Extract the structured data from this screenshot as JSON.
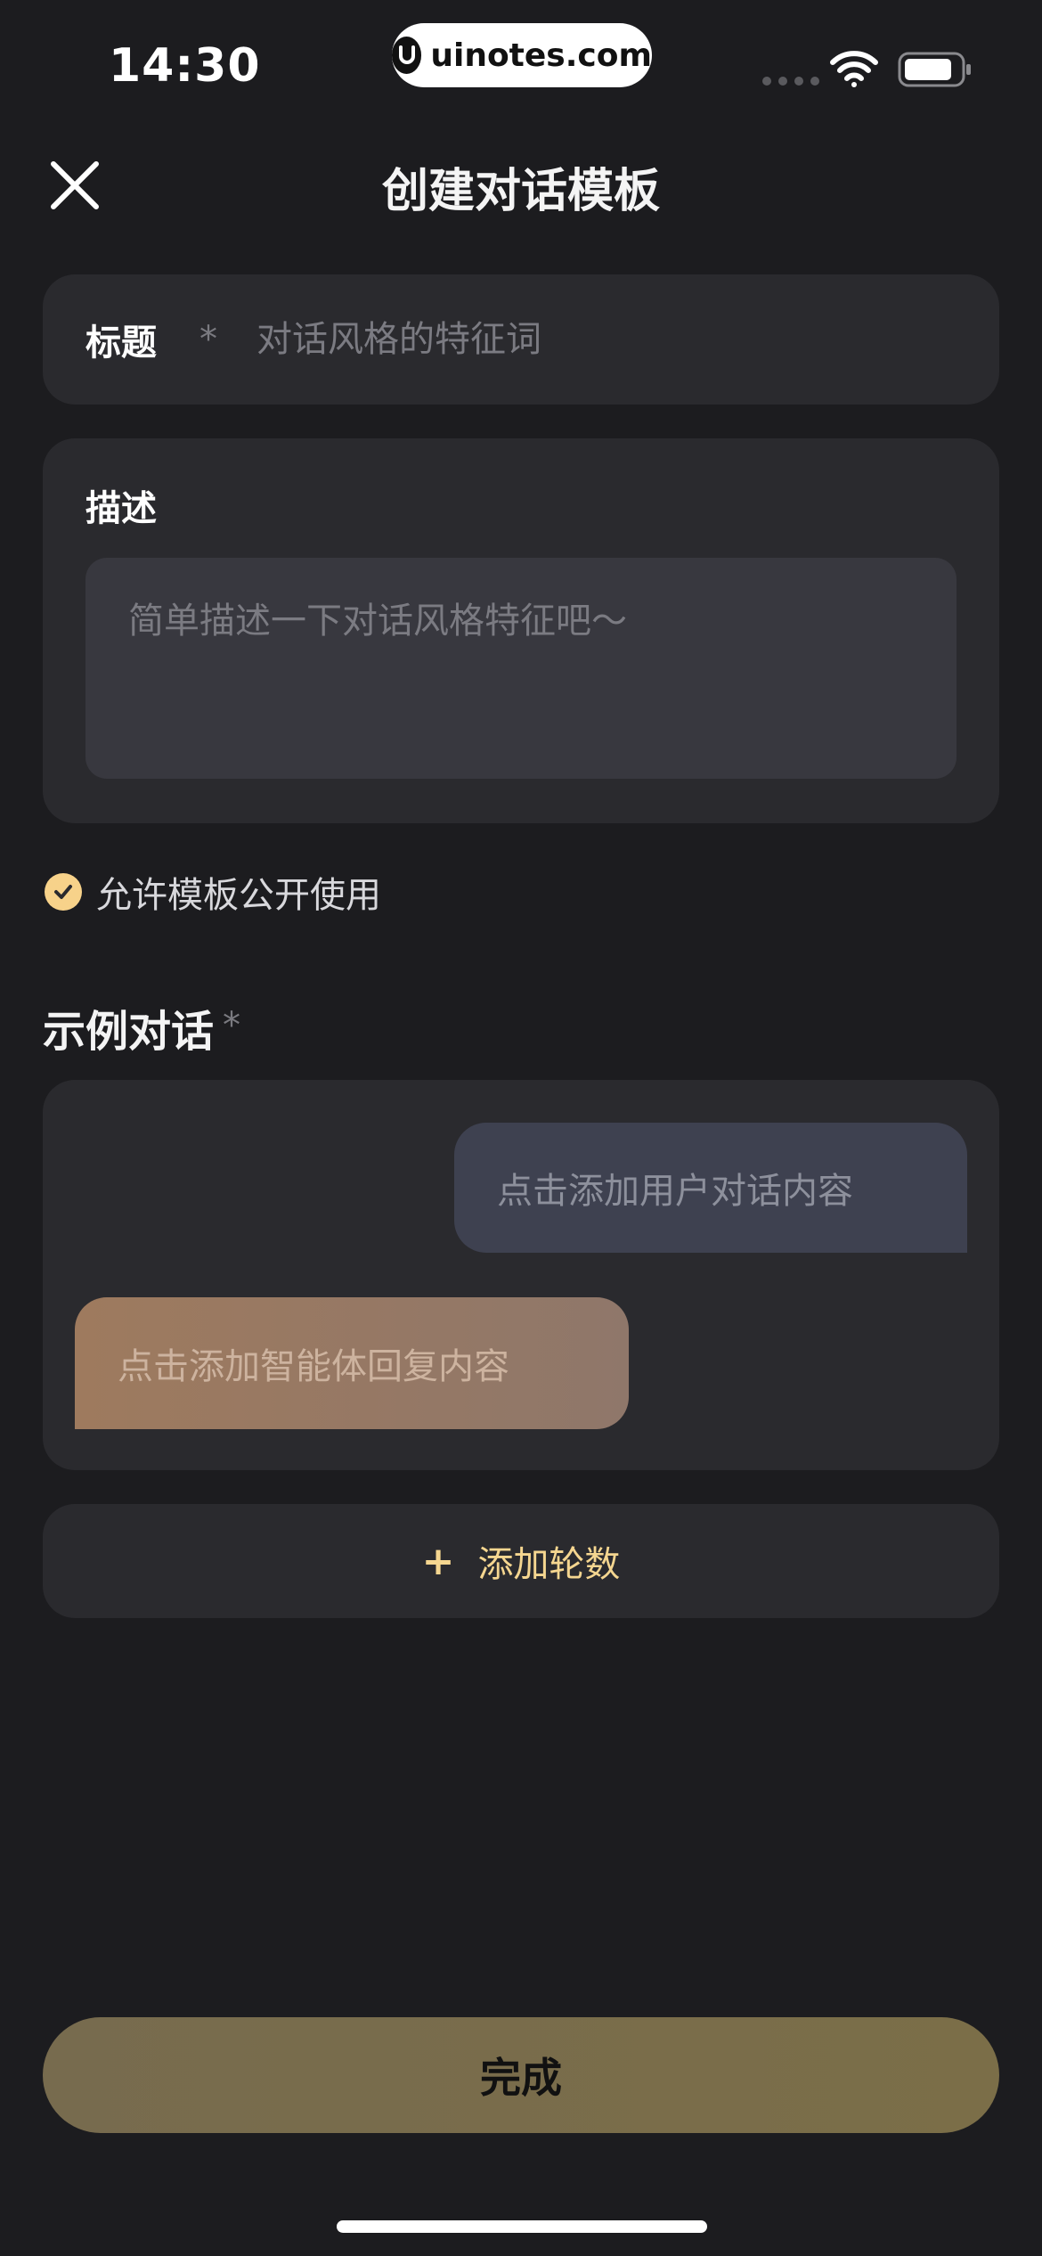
{
  "status_bar": {
    "time": "14:30",
    "watermark": "uinotes.com",
    "icons": [
      "signal-dots-icon",
      "wifi-icon",
      "battery-icon"
    ]
  },
  "header": {
    "title": "创建对话模板",
    "close_icon": "close-icon"
  },
  "title_field": {
    "label": "标题",
    "required_mark": "*",
    "placeholder": "对话风格的特征词"
  },
  "description_field": {
    "label": "描述",
    "placeholder": "简单描述一下对话风格特征吧～"
  },
  "public_option": {
    "label": "允许模板公开使用",
    "checked": true
  },
  "example_dialog": {
    "title": "示例对话",
    "required_mark": "*",
    "user_placeholder": "点击添加用户对话内容",
    "agent_placeholder": "点击添加智能体回复内容"
  },
  "add_round": {
    "icon": "+",
    "label": "添加轮数"
  },
  "done_button": {
    "label": "完成"
  },
  "colors": {
    "background": "#1c1c1f",
    "card": "#2a2a2e",
    "accent": "#f7d28a",
    "done_button": "#776b4e"
  }
}
